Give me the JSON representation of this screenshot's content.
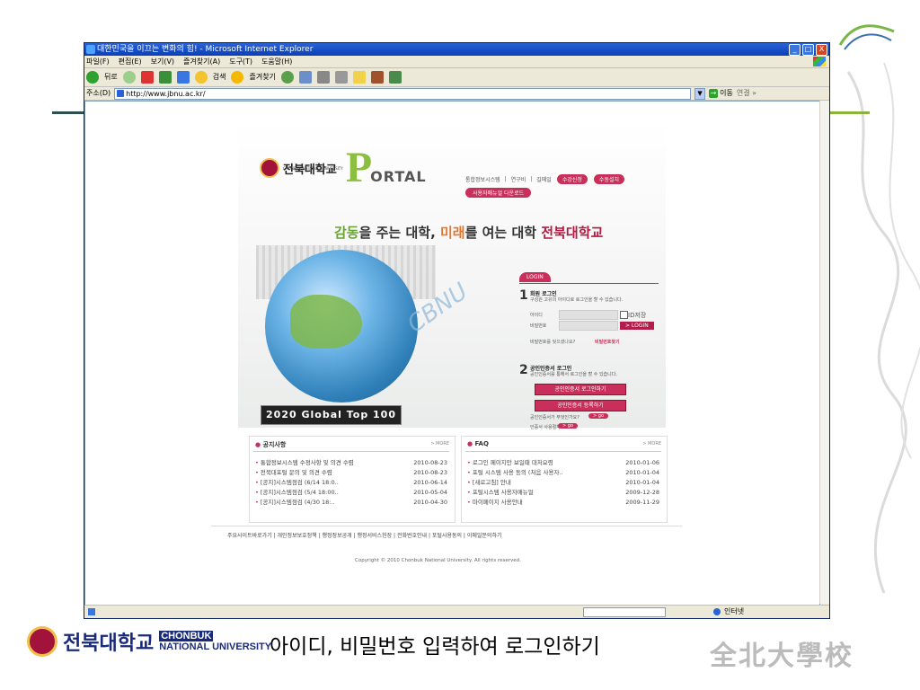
{
  "window": {
    "title": "대한민국을 이끄는 변화의 힘! - Microsoft Internet Explorer",
    "buttons": [
      "_",
      "□",
      "X"
    ]
  },
  "menu": [
    "파일(F)",
    "편집(E)",
    "보기(V)",
    "즐겨찾기(A)",
    "도구(T)",
    "도움말(H)"
  ],
  "toolbar": {
    "back": "뒤로",
    "search": "검색",
    "favorites": "즐겨찾기"
  },
  "address": {
    "label": "주소(D)",
    "url": "http://www.jbnu.ac.kr/",
    "go": "이동",
    "links": "연결 »"
  },
  "status": {
    "zone": "인터넷"
  },
  "portal": {
    "univ_name": "전북대학교",
    "univ_en": "CHONBUK NATIONAL UNIVERSITY",
    "logo_p": "P",
    "logo_rest": "ORTAL",
    "top_links": [
      "통합정보시스템",
      "연구비",
      "길메일"
    ],
    "pill_apply": "수강신청",
    "pill_install": "수동설치",
    "manual": "사용자매뉴얼 다운로드",
    "slogan": {
      "part1": "감동",
      "part2": "을 주는 ",
      "part3": "대학, ",
      "part4": "미래",
      "part5": "를 여는 ",
      "part6": "대학 ",
      "part7": "전북대학교"
    },
    "cbnu": "CBNU",
    "global_top": "2020 Global Top 100",
    "login": {
      "tab": "LOGIN",
      "num1": "1",
      "member_title": "회원 로그인",
      "member_desc": "구성원 고유의 아이디로 로그인을 할 수 있습니다.",
      "id_label": "아이디",
      "pw_label": "비밀번호",
      "save_id": "ID저장",
      "login_btn": "> LOGIN",
      "forgot": "비밀번호를 잊으셨나요?",
      "find_pw": "비밀번호찾기",
      "num2": "2",
      "cert_title": "공인인증서 로그인",
      "cert_desc": "공인인증서를 통해서 로그인을 할 수 있습니다.",
      "cert_login": "공인인증서 로그인하기",
      "cert_register": "공인인증서 등록하기",
      "cert_what": "공인인증서가 무엇인가요?",
      "cert_proc": "인증서 사용절차",
      "go": "> go"
    }
  },
  "notice": {
    "title": "공지사항",
    "more": "> MORE",
    "rows": [
      {
        "text": "통합정보시스템 수정사항 및 의견 수렴",
        "date": "2010-08-23"
      },
      {
        "text": "전북대포털 문의 및 의견 수렴",
        "date": "2010-08-23"
      },
      {
        "text": "[공지]시스템점검 (6/14 18:0..",
        "date": "2010-06-14"
      },
      {
        "text": "[공지]시스템점검 (5/4 18:00..",
        "date": "2010-05-04"
      },
      {
        "text": "[공지]시스템점검 (4/30 18:..",
        "date": "2010-04-30"
      }
    ]
  },
  "faq": {
    "title": "FAQ",
    "more": "> MORE",
    "rows": [
      {
        "text": "로그인 페이지만 보일때 대처요령",
        "date": "2010-01-06"
      },
      {
        "text": "포털 시스템 사용 동의 (처음 사용자..",
        "date": "2010-01-04"
      },
      {
        "text": "[새로고침] 안내",
        "date": "2010-01-04"
      },
      {
        "text": "포털시스템 사용자매뉴얼",
        "date": "2009-12-28"
      },
      {
        "text": "마이페이지 사용안내",
        "date": "2009-11-29"
      }
    ]
  },
  "footer": {
    "links": "주요사이트바로가기 | 개인정보보호정책 | 행정정보공개 | 행정서비스헌장 | 전화번호안내 | 포털사용동의 | 이메일문의하기",
    "copyright": "Copyright © 2010 Chonbuk National University. All rights reserved."
  },
  "slide": {
    "univ_name": "전북대학교",
    "univ_en_1": "CHONBUK",
    "univ_en_2": "NATIONAL UNIVERSITY",
    "caption": "아이디, 비밀번호 입력하여 로그인하기",
    "hanja": "全北大學校"
  },
  "colors": {
    "accent": "#c8305b",
    "green": "#8cbf3f",
    "navy": "#1a2a7a",
    "xp_blue": "#2a62d7"
  }
}
